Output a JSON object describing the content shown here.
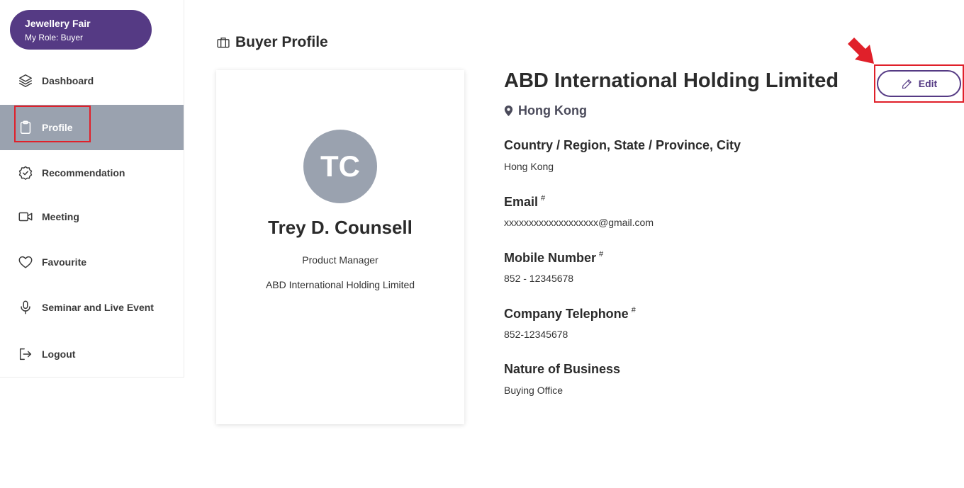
{
  "fair": {
    "name": "Jewellery Fair",
    "role": "My Role: Buyer"
  },
  "sidebar": {
    "items": [
      {
        "label": "Dashboard",
        "icon": "layers-icon",
        "active": false
      },
      {
        "label": "Profile",
        "icon": "clipboard-icon",
        "active": true
      },
      {
        "label": "Recommendation",
        "icon": "badge-check-icon",
        "active": false
      },
      {
        "label": "Meeting",
        "icon": "video-camera-icon",
        "active": false
      },
      {
        "label": "Favourite",
        "icon": "heart-icon",
        "active": false
      },
      {
        "label": "Seminar and Live Event",
        "icon": "microphone-icon",
        "active": false
      },
      {
        "label": "Logout",
        "icon": "logout-icon",
        "active": false
      }
    ]
  },
  "page": {
    "title": "Buyer Profile",
    "title_icon": "briefcase-icon"
  },
  "profile_card": {
    "initials": "TC",
    "name": "Trey D. Counsell",
    "job_title": "Product Manager",
    "company": "ABD International Holding Limited"
  },
  "details": {
    "company_name": "ABD International Holding Limited",
    "location": "Hong Kong",
    "fields": [
      {
        "label": "Country / Region, State / Province, City",
        "marker": "",
        "value": "Hong Kong"
      },
      {
        "label": "Email",
        "marker": "#",
        "value": "xxxxxxxxxxxxxxxxxxx@gmail.com"
      },
      {
        "label": "Mobile Number",
        "marker": "#",
        "value": "852 - 12345678"
      },
      {
        "label": "Company Telephone",
        "marker": "#",
        "value": "852-12345678"
      },
      {
        "label": "Nature of Business",
        "marker": "",
        "value": "Buying Office"
      }
    ]
  },
  "actions": {
    "edit_label": "Edit"
  },
  "colors": {
    "brand_purple": "#553a84",
    "active_nav_bg": "#9aa2af",
    "avatar_bg": "#9aa2af",
    "highlight_red": "#e0202a"
  }
}
